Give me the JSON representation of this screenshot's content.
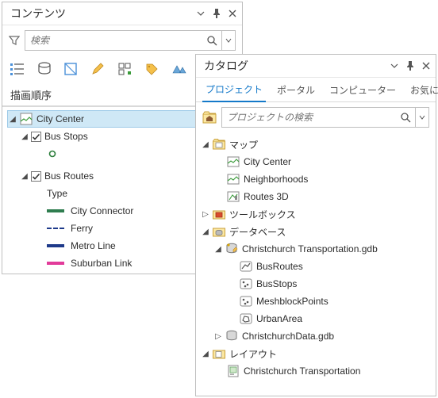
{
  "contents": {
    "title": "コンテンツ",
    "searchPlaceholder": "検索",
    "drawingOrder": "描画順序",
    "cityCenter": "City Center",
    "busStops": "Bus Stops",
    "busRoutes": "Bus Routes",
    "type": "Type",
    "routeNames": [
      "City Connector",
      "Ferry",
      "Metro Line",
      "Suburban Link"
    ]
  },
  "catalog": {
    "title": "カタログ",
    "tabs": [
      "プロジェクト",
      "ポータル",
      "コンピューター",
      "お気に入り"
    ],
    "searchPlaceholder": "プロジェクトの検索",
    "maps": {
      "label": "マップ",
      "items": [
        "City Center",
        "Neighborhoods",
        "Routes 3D"
      ]
    },
    "toolboxes": "ツールボックス",
    "databases": {
      "label": "データベース",
      "gdb1": {
        "name": "Christchurch Transportation.gdb",
        "items": [
          "BusRoutes",
          "BusStops",
          "MeshblockPoints",
          "UrbanArea"
        ]
      },
      "gdb2": "ChristchurchData.gdb"
    },
    "layouts": {
      "label": "レイアウト",
      "item": "Christchurch Transportation"
    }
  }
}
